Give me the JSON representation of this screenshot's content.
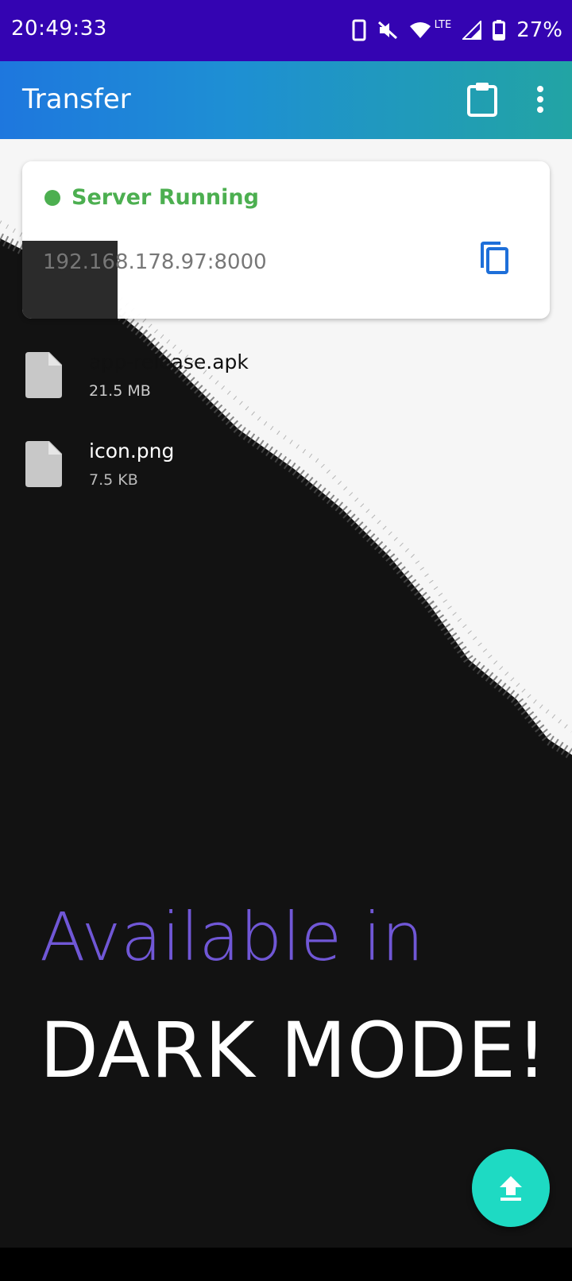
{
  "status_bar": {
    "time": "20:49:33",
    "network": "LTE",
    "battery": "27%"
  },
  "app_bar": {
    "title": "Transfer",
    "icons": [
      "clipboard-icon",
      "more-vert-icon"
    ]
  },
  "server": {
    "status": "Server Running",
    "status_color": "#4caf50",
    "address": "192.168.178.97:8000"
  },
  "files": [
    {
      "name": "app-release.apk",
      "size": "21.5 MB"
    },
    {
      "name": "icon.png",
      "size": "7.5 KB"
    }
  ],
  "promo": {
    "line1": "Available in",
    "line2": "DARK MODE!"
  },
  "colors": {
    "status_bar": "#3404b2",
    "fab": "#1edac3",
    "accent_purple": "#7057d6",
    "copy_icon": "#1e6fd9"
  }
}
